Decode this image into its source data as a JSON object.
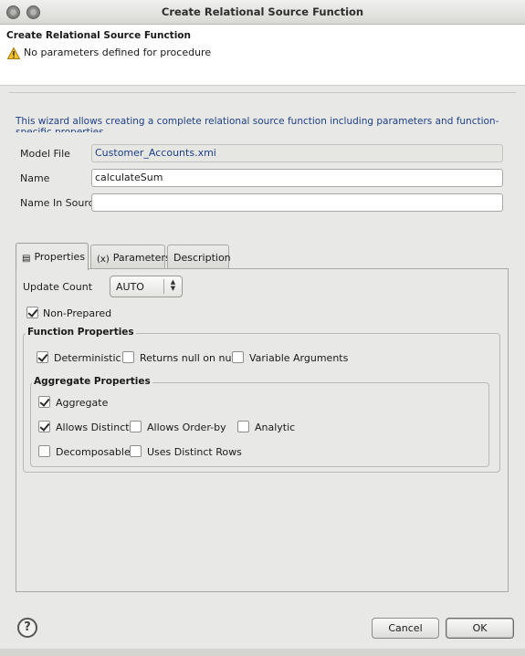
{
  "window": {
    "title": "Create Relational Source Function"
  },
  "header": {
    "title": "Create Relational Source Function",
    "message": "No parameters defined for procedure"
  },
  "description": "This wizard allows creating a complete relational source function including parameters and function-specific properties",
  "form": {
    "model_file_label": "Model File",
    "model_file_value": "Customer_Accounts.xmi",
    "name_label": "Name",
    "name_value": "calculateSum",
    "name_in_source_label": "Name In Source",
    "name_in_source_value": ""
  },
  "tabs": [
    {
      "label": "Properties",
      "icon": "properties-icon",
      "active": true
    },
    {
      "label": "Parameters",
      "icon": "parameters-icon",
      "active": false
    },
    {
      "label": "Description",
      "active": false
    }
  ],
  "properties": {
    "update_count_label": "Update Count",
    "update_count_value": "AUTO",
    "non_prepared_label": "Non-Prepared",
    "non_prepared_checked": true,
    "function_properties": {
      "title": "Function Properties",
      "deterministic": {
        "label": "Deterministic",
        "checked": true
      },
      "returns_null": {
        "label": "Returns null on null",
        "checked": false
      },
      "variable_arguments": {
        "label": "Variable Arguments",
        "checked": false
      }
    },
    "aggregate_properties": {
      "title": "Aggregate Properties",
      "aggregate": {
        "label": "Aggregate",
        "checked": true
      },
      "allows_distinct": {
        "label": "Allows Distinct",
        "checked": true
      },
      "allows_order_by": {
        "label": "Allows Order-by",
        "checked": false
      },
      "analytic": {
        "label": "Analytic",
        "checked": false
      },
      "decomposable": {
        "label": "Decomposable",
        "checked": false
      },
      "uses_distinct_rows": {
        "label": "Uses Distinct Rows",
        "checked": false
      }
    }
  },
  "buttons": {
    "help": "?",
    "cancel": "Cancel",
    "ok": "OK"
  },
  "colors": {
    "link_text": "#1d3f8a",
    "window_bg": "#e8e8e6",
    "header_bg": "#ffffff"
  }
}
